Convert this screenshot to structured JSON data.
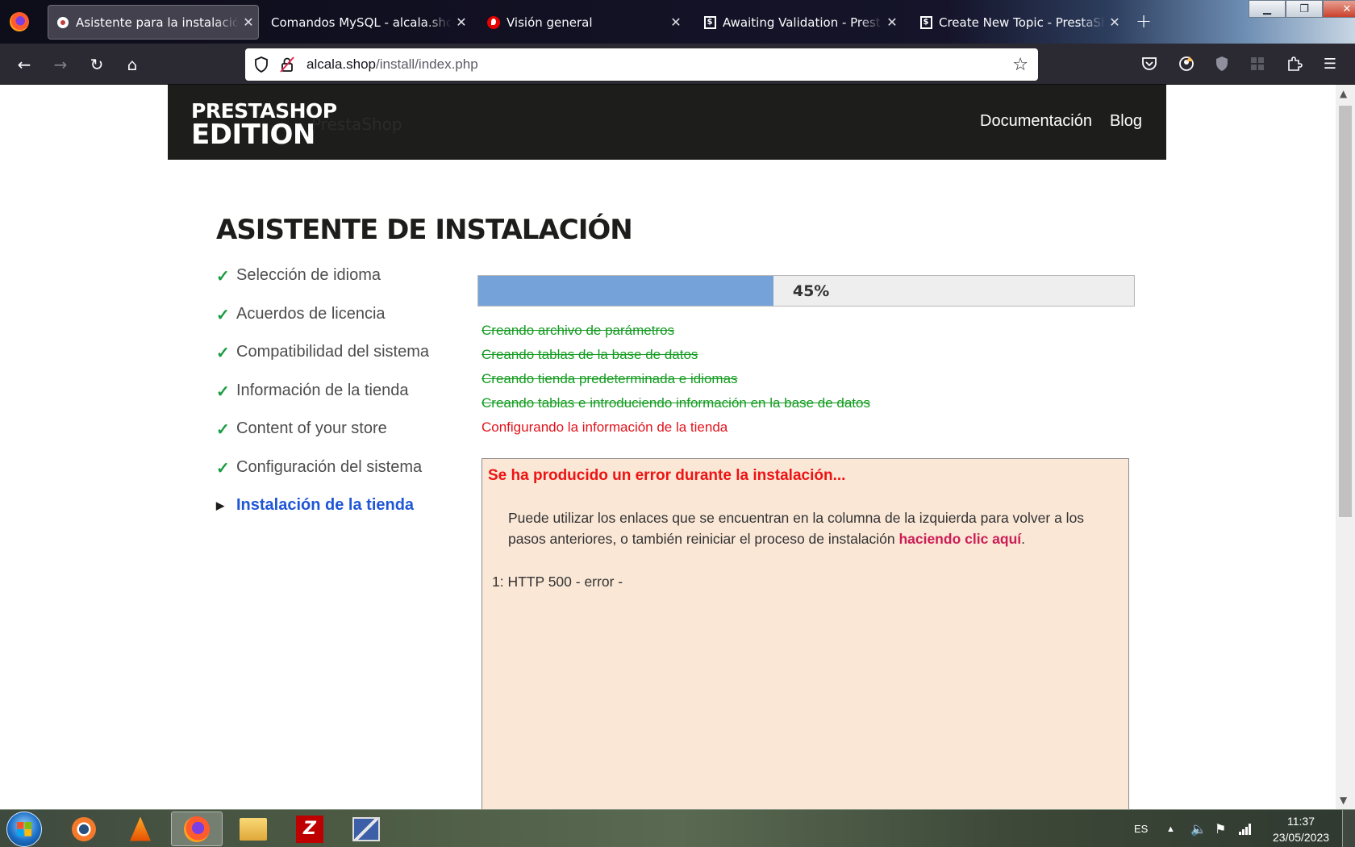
{
  "browser": {
    "tabs": [
      {
        "label": "Asistente para la instalación de PrestaShop",
        "icon": "puzzle-icon",
        "active": true
      },
      {
        "label": "Comandos MySQL - alcala.shop",
        "icon": "",
        "active": false
      },
      {
        "label": "Visión general",
        "icon": "vodafone-icon",
        "active": false
      },
      {
        "label": "Awaiting Validation - PrestaShop",
        "icon": "prestashop-icon",
        "active": false
      },
      {
        "label": "Create New Topic - PrestaShop",
        "icon": "prestashop-icon",
        "active": false
      }
    ],
    "url_domain": "alcala.shop",
    "url_path": "/install/index.php"
  },
  "site": {
    "logo_line1": "PRESTASHOP",
    "logo_line2": "EDITION",
    "ghost_text": "PrestaShop",
    "nav": [
      "Documentación",
      "Blog"
    ]
  },
  "wizard": {
    "title": "ASISTENTE DE INSTALACIÓN",
    "steps": [
      {
        "label": "Selección de idioma",
        "status": "done"
      },
      {
        "label": "Acuerdos de licencia",
        "status": "done"
      },
      {
        "label": "Compatibilidad del sistema",
        "status": "done"
      },
      {
        "label": "Información de la tienda",
        "status": "done"
      },
      {
        "label": "Content of your store",
        "status": "done"
      },
      {
        "label": "Configuración del sistema",
        "status": "done"
      },
      {
        "label": "Instalación de la tienda",
        "status": "current"
      }
    ],
    "progress_percent": 45,
    "progress_label": "45%",
    "log": [
      {
        "text": "Creando archivo de parámetros",
        "status": "done"
      },
      {
        "text": "Creando tablas de la base de datos",
        "status": "done"
      },
      {
        "text": "Creando tienda predeterminada e idiomas",
        "status": "done"
      },
      {
        "text": "Creando tablas e introduciendo información en la base de datos",
        "status": "done"
      },
      {
        "text": "Configurando la información de la tienda",
        "status": "error"
      }
    ],
    "error": {
      "title": "Se ha producido un error durante la instalación...",
      "message_before": "Puede utilizar los enlaces que se encuentran en la columna de la izquierda para volver a los pasos anteriores, o también reiniciar el proceso de instalación ",
      "link_text": "haciendo clic aquí",
      "message_after": ".",
      "code": "1: HTTP 500 - error -"
    }
  },
  "taskbar": {
    "language": "ES",
    "time": "11:37",
    "date": "23/05/2023",
    "apps": [
      "blender-icon",
      "vlc-icon",
      "firefox-icon",
      "folder-icon",
      "filezilla-icon",
      "network-icon"
    ]
  },
  "colors": {
    "header_bg": "#1d1d1b",
    "progress_fill": "#75a3d9",
    "done_green": "#139c20",
    "error_red": "#e3131b",
    "current_step_blue": "#1f56d6",
    "error_box_bg": "#fae7d6"
  }
}
